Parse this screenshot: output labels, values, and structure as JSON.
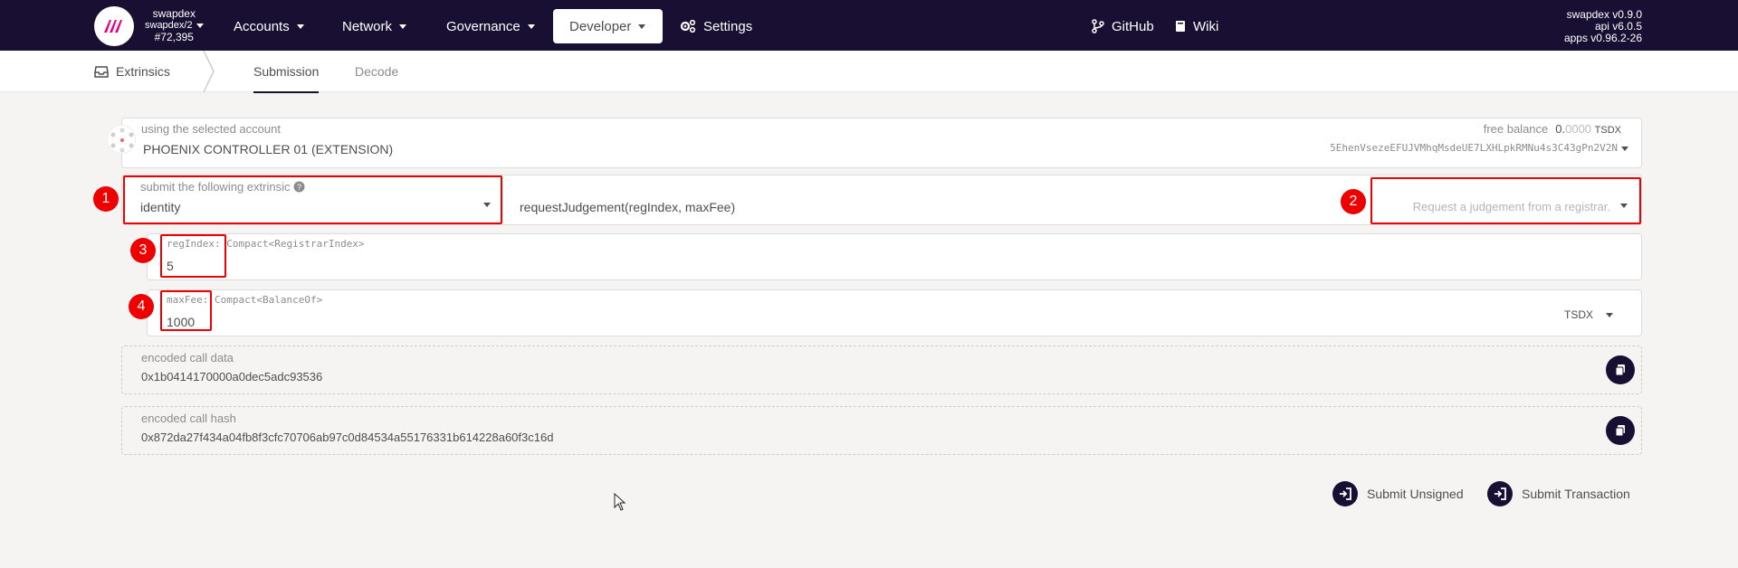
{
  "header": {
    "chain_name": "swapdex",
    "chain_spec": "swapdex/2",
    "block": "#72,395",
    "nav": {
      "accounts": "Accounts",
      "network": "Network",
      "governance": "Governance",
      "developer": "Developer",
      "settings": "Settings",
      "github": "GitHub",
      "wiki": "Wiki"
    },
    "versions": {
      "node": "swapdex v0.9.0",
      "api": "api v6.0.5",
      "apps": "apps v0.96.2-26"
    }
  },
  "tabs": {
    "section": "Extrinsics",
    "submission": "Submission",
    "decode": "Decode"
  },
  "account": {
    "label": "using the selected account",
    "name": "PHOENIX CONTROLLER 01 (EXTENSION)",
    "balance_label": "free balance",
    "balance_int": "0.",
    "balance_dec": "0000",
    "balance_unit": "TSDX",
    "address": "5EhenVsezeEFUJVMhqMsdeUE7LXHLpkRMNu4s3C43gPn2V2N"
  },
  "extrinsic": {
    "label": "submit the following extrinsic",
    "module": "identity",
    "method": "requestJudgement(regIndex, maxFee)",
    "description": "Request a judgement from a registrar."
  },
  "params": {
    "regindex": {
      "name": "regIndex:",
      "type": "Compact<RegistrarIndex>",
      "value": "5"
    },
    "maxfee": {
      "name": "maxFee:",
      "type": "Compact<BalanceOf>",
      "value": "1000",
      "unit": "TSDX"
    }
  },
  "encoded": {
    "data_label": "encoded call data",
    "data_value": "0x1b0414170000a0dec5adc93536",
    "hash_label": "encoded call hash",
    "hash_value": "0x872da27f434a04fb8f3cfc70706ab97c0d84534a55176331b614228a60f3c16d"
  },
  "actions": {
    "unsigned": "Submit Unsigned",
    "transaction": "Submit Transaction"
  },
  "badges": [
    "1",
    "2",
    "3",
    "4"
  ],
  "colors": {
    "nav_bg": "#180f33",
    "highlight": "#ee0000",
    "logo_accent": "#e6007a"
  }
}
